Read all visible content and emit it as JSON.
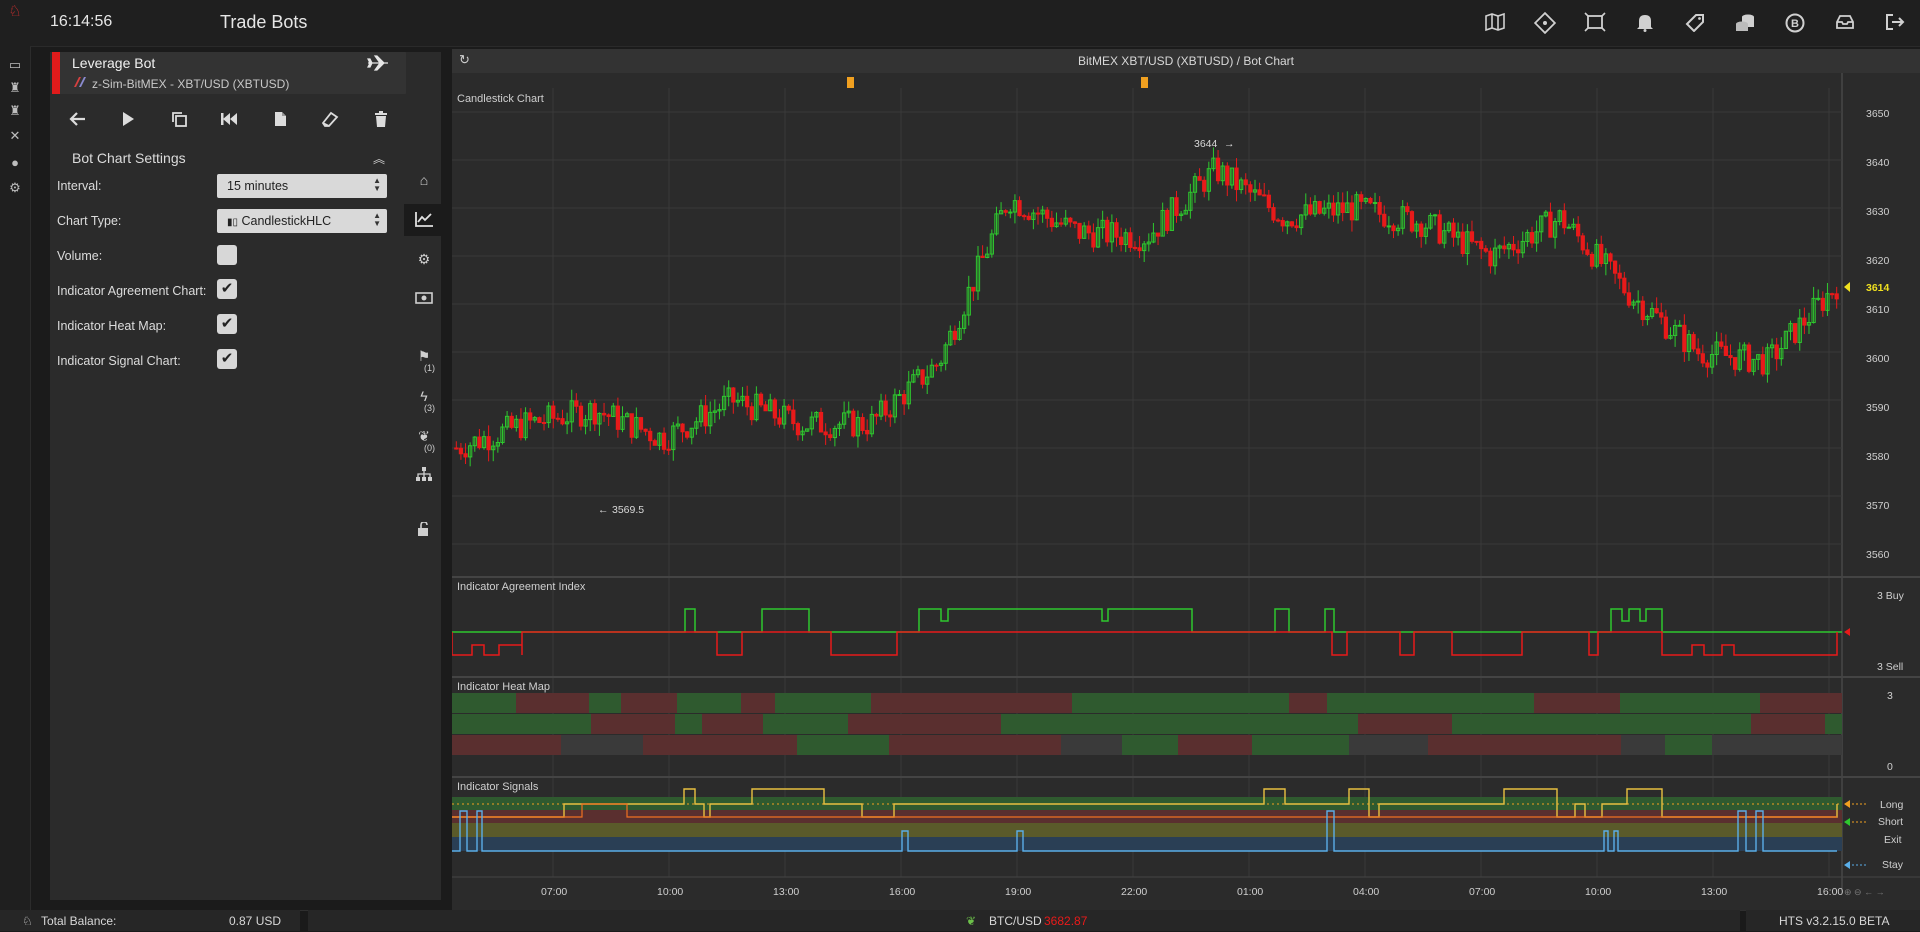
{
  "app": {
    "clock": "16:14:56",
    "title": "Trade Bots",
    "top_icons": [
      "map-icon",
      "ticket-icon",
      "screen-frame-icon",
      "bell-icon",
      "tag-icon",
      "coins-icon",
      "bitcoin-cycle-icon",
      "inbox-icon",
      "sign-out-icon"
    ]
  },
  "rail_icons": [
    "logo-icon",
    "monitor-icon",
    "bot-icon",
    "bot-alt-icon",
    "tools-icon",
    "user-icon",
    "settings-icon"
  ],
  "bot": {
    "name": "Leverage Bot",
    "exchange": "z-Sim-BitMEX - XBT/USD (XBTUSD)",
    "toolbar": [
      "back-arrow-icon",
      "play-icon",
      "copy-icon",
      "rewind-icon",
      "document-icon",
      "eraser-icon",
      "trash-icon"
    ]
  },
  "settings": {
    "title": "Bot Chart Settings",
    "interval_label": "Interval:",
    "interval_value": "15 minutes",
    "chart_type_label": "Chart Type:",
    "chart_type_value": "CandlestickHLC",
    "volume_label": "Volume:",
    "volume_checked": false,
    "agreement_label": "Indicator Agreement Chart:",
    "agreement_checked": true,
    "heatmap_label": "Indicator Heat Map:",
    "heatmap_checked": true,
    "signal_label": "Indicator Signal Chart:",
    "signal_checked": true
  },
  "side": {
    "counts": [
      "(1)",
      "(3)",
      "(0)"
    ]
  },
  "chart": {
    "header": "BitMEX XBT/USD (XBTUSD) / Bot Chart",
    "candle_title": "Candlestick Chart",
    "agreement_title": "Indicator Agreement Index",
    "heat_title": "Indicator Heat Map",
    "signals_title": "Indicator Signals",
    "price_ticks": [
      "3650",
      "3640",
      "3630",
      "3620",
      "3610",
      "3600",
      "3590",
      "3580",
      "3570",
      "3560"
    ],
    "last_price": "3614",
    "high_label": "3644",
    "low_label": "3569.5",
    "agreement_ticks": [
      "3 Buy",
      "3 Sell"
    ],
    "heat_ticks": [
      "3",
      "0"
    ],
    "signal_ticks": [
      "Long",
      "Short",
      "Exit",
      "Stay"
    ],
    "time_ticks": [
      "07:00",
      "10:00",
      "13:00",
      "16:00",
      "19:00",
      "22:00",
      "01:00",
      "04:00",
      "07:00",
      "10:00",
      "13:00",
      "16:00"
    ],
    "colors": {
      "up": "#2ec82e",
      "down": "#e81a1a",
      "accent": "#f0a020",
      "signal_blue": "#5aaee8",
      "bg": "#2b2b2b"
    }
  },
  "chart_data": {
    "type": "candlestick",
    "title": "Candlestick Chart",
    "ylim": [
      3555,
      3655
    ],
    "x": [
      "07:00",
      "10:00",
      "13:00",
      "16:00",
      "19:00",
      "22:00",
      "01:00",
      "04:00",
      "07:00",
      "10:00",
      "13:00",
      "16:00"
    ],
    "close_trace": [
      3580,
      3585,
      3588,
      3582,
      3590,
      3585,
      3585,
      3598,
      3632,
      3625,
      3624,
      3638,
      3628,
      3630,
      3627,
      3620,
      3628,
      3612,
      3600,
      3598,
      3614
    ],
    "annotations": [
      {
        "label": "3644",
        "value": 3644
      },
      {
        "label": "3569.5",
        "value": 3569.5
      }
    ],
    "last_price": 3614
  },
  "status": {
    "total_balance_label": "Total Balance:",
    "total_balance_value": "0.87 USD",
    "pair": "BTC/USD",
    "pair_price": "3682.87",
    "version": "HTS v3.2.15.0 BETA"
  }
}
